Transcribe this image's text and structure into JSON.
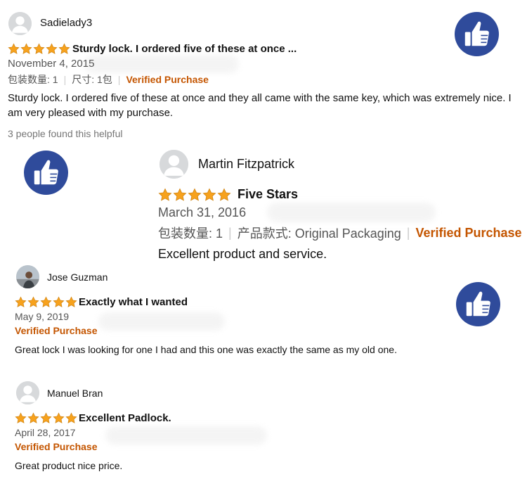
{
  "reviews": [
    {
      "reviewer": "Sadielady3",
      "rating": 5,
      "title": "Sturdy lock. I ordered five of these at once ...",
      "date": "November 4, 2015",
      "attr1": "包装数量: 1",
      "attr2": "尺寸: 1包",
      "verified": "Verified Purchase",
      "body": "Sturdy lock. I ordered five of these at once and they all came with the same key, which was extremely nice. I am very pleased with my purchase.",
      "helpful": "3 people found this helpful"
    },
    {
      "reviewer": "Martin Fitzpatrick",
      "rating": 5,
      "title": "Five Stars",
      "date": "March 31, 2016",
      "attr1": "包装数量: 1",
      "attr2": "产品款式: Original Packaging",
      "verified": "Verified Purchase",
      "body": "Excellent product and service."
    },
    {
      "reviewer": "Jose Guzman",
      "rating": 5,
      "title": "Exactly what I wanted",
      "date": "May 9, 2019",
      "verified": "Verified Purchase",
      "body": "Great lock I was looking for one I had and this one was exactly the same as my old one."
    },
    {
      "reviewer": "Manuel Bran",
      "rating": 5,
      "title": "Excellent Padlock.",
      "date": "April 28, 2017",
      "verified": "Verified Purchase",
      "body": "Great product nice price."
    }
  ],
  "colors": {
    "star": "#f7a21d",
    "verified": "#c45500",
    "thumb_bg": "#2f4b9b"
  },
  "icons": [
    "default-avatar-icon",
    "star-icon",
    "thumbs-up-icon"
  ]
}
